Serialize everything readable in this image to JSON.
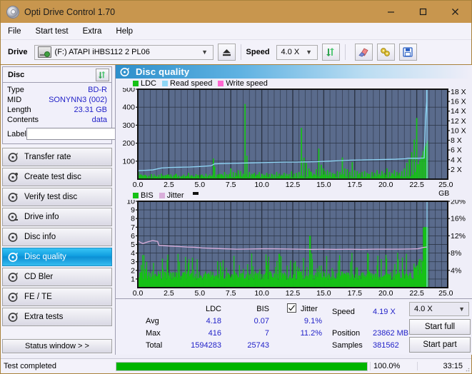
{
  "titlebar": {
    "title": "Opti Drive Control 1.70",
    "icon": "disc-icon",
    "minimize": "–",
    "maximize": "□",
    "close": "✕"
  },
  "menubar": {
    "items": [
      "File",
      "Start test",
      "Extra",
      "Help"
    ]
  },
  "toolbar": {
    "drive_label": "Drive",
    "drive_value": "(F:)  ATAPI iHBS112  2 PL06",
    "eject_icon": "eject-icon",
    "speed_label": "Speed",
    "speed_value": "4.0 X",
    "refresh_icon": "refresh-icon",
    "eraser_icon": "eraser-icon",
    "tools_icon": "tools-icon",
    "save_icon": "save-disk-icon"
  },
  "sidebar": {
    "disc": {
      "header": "Disc",
      "refresh_icon": "refresh-icon",
      "rows": [
        {
          "key": "Type",
          "value": "BD-R"
        },
        {
          "key": "MID",
          "value": "SONYNN3 (002)"
        },
        {
          "key": "Length",
          "value": "23.31 GB"
        },
        {
          "key": "Contents",
          "value": "data"
        }
      ],
      "label_key": "Label",
      "label_value": "",
      "label_placeholder": "",
      "disc_button_icon": "cd-disc-icon"
    },
    "nav": [
      {
        "label": "Transfer rate",
        "icon": "disc-test-icon",
        "active": false
      },
      {
        "label": "Create test disc",
        "icon": "disc-burn-icon",
        "active": false
      },
      {
        "label": "Verify test disc",
        "icon": "disc-verify-icon",
        "active": false
      },
      {
        "label": "Drive info",
        "icon": "drive-info-icon",
        "active": false
      },
      {
        "label": "Disc info",
        "icon": "disc-info-icon",
        "active": false
      },
      {
        "label": "Disc quality",
        "icon": "disc-quality-icon",
        "active": true
      },
      {
        "label": "CD Bler",
        "icon": "cd-bler-icon",
        "active": false
      },
      {
        "label": "FE / TE",
        "icon": "fe-te-icon",
        "active": false
      },
      {
        "label": "Extra tests",
        "icon": "extra-tests-icon",
        "active": false
      }
    ],
    "status_window_button": "Status window > >"
  },
  "panel": {
    "title": "Disc quality",
    "icon": "disc-quality-icon"
  },
  "stats": {
    "col_ldc": "LDC",
    "col_bis": "BIS",
    "jitter_label": "Jitter",
    "jitter_checked": true,
    "rows": [
      {
        "label": "Avg",
        "ldc": "4.18",
        "bis": "0.07",
        "jitter": "9.1%"
      },
      {
        "label": "Max",
        "ldc": "416",
        "bis": "7",
        "jitter": "11.2%"
      },
      {
        "label": "Total",
        "ldc": "1594283",
        "bis": "25743",
        "jitter": ""
      }
    ],
    "speed_label": "Speed",
    "speed_value": "4.19 X",
    "position_label": "Position",
    "position_value": "23862 MB",
    "samples_label": "Samples",
    "samples_value": "381562",
    "speed_select": "4.0 X",
    "start_full": "Start full",
    "start_part": "Start part"
  },
  "statusbar": {
    "message": "Test completed",
    "percent_text": "100.0%",
    "percent_value": 100,
    "time": "33:15"
  },
  "colors": {
    "titlebar": "#C8964E",
    "plot_bg": "#5A6B8C",
    "grid": "#2B3445",
    "ldc_green": "#16C116",
    "read_speed": "#8FD6F5",
    "write_speed": "#FF66D0",
    "jitter_pink": "#D9AEDA",
    "accent_blue": "#2222C8",
    "progress_green": "#00B400",
    "nav_active": "#0F9DE0"
  },
  "chart_data": [
    {
      "type": "line",
      "name": "top-chart",
      "title": "Disc quality",
      "legend": [
        {
          "label": "LDC",
          "color": "#16C116"
        },
        {
          "label": "Read speed",
          "color": "#8FD6F5"
        },
        {
          "label": "Write speed",
          "color": "#FF66D0"
        }
      ],
      "legend_position": "top-left",
      "grid": true,
      "xlabel": "GB",
      "xlim": [
        0,
        25
      ],
      "xticks": [
        0.0,
        2.5,
        5.0,
        7.5,
        10.0,
        12.5,
        15.0,
        17.5,
        20.0,
        22.5,
        25.0
      ],
      "xticklabels": [
        "0.0",
        "2.5",
        "5.0",
        "7.5",
        "10.0",
        "12.5",
        "15.0",
        "17.5",
        "20.0",
        "22.5",
        "25.0 GB"
      ],
      "ylabel": "LDC",
      "ylim": [
        0,
        500
      ],
      "yticks": [
        100,
        200,
        300,
        400,
        500
      ],
      "yticklabels": [
        "100",
        "200",
        "300",
        "400",
        "500"
      ],
      "y2label": "Speed",
      "y2lim": [
        0,
        18.5
      ],
      "y2ticks": [
        2,
        4,
        6,
        8,
        10,
        12,
        14,
        16,
        18
      ],
      "y2ticklabels": [
        "2 X",
        "4 X",
        "6 X",
        "8 X",
        "10 X",
        "12 X",
        "14 X",
        "16 X",
        "18 X"
      ],
      "series": [
        {
          "name": "LDC",
          "type": "bar",
          "color": "#16C116",
          "axis": "left",
          "x": [
            0.05,
            0.2,
            0.35,
            0.5,
            0.7,
            0.9,
            1.1,
            1.3,
            1.5,
            1.7,
            1.9,
            2.1,
            2.3,
            2.5,
            2.7,
            2.9,
            3.1,
            3.3,
            3.5,
            3.7,
            3.9,
            4.1,
            4.3,
            4.5,
            4.7,
            4.9,
            5.1,
            5.3,
            5.5,
            5.7,
            5.9,
            6.1,
            6.2,
            6.4,
            6.6,
            6.8,
            7.0,
            7.2,
            7.4,
            7.5,
            7.7,
            7.9,
            8.1,
            8.3,
            8.5,
            8.65,
            8.8,
            9.0,
            9.2,
            9.4,
            9.6,
            9.8,
            10.0,
            10.2,
            10.4,
            10.6,
            10.8,
            11.0,
            11.2,
            11.4,
            11.6,
            11.8,
            12.0,
            12.2,
            12.4,
            12.6,
            12.8,
            13.0,
            13.2,
            13.4,
            13.6,
            13.8,
            13.9,
            14.0,
            14.2,
            14.4,
            14.6,
            14.8,
            14.95,
            15.1,
            15.3,
            15.5,
            15.7,
            15.9,
            16.1,
            16.3,
            16.5,
            16.7,
            16.9,
            17.1,
            17.3,
            17.5,
            17.7,
            17.9,
            18.1,
            18.3,
            18.5,
            18.7,
            18.9,
            19.1,
            19.3,
            19.5,
            19.7,
            19.9,
            20.1,
            20.3,
            20.5,
            20.7,
            20.9,
            21.1,
            21.3,
            21.5,
            21.7,
            21.9,
            22.1,
            22.3,
            22.5,
            22.7,
            22.9,
            23.0,
            23.1,
            23.2,
            23.3
          ],
          "values": [
            40,
            25,
            18,
            22,
            16,
            20,
            28,
            15,
            18,
            24,
            30,
            20,
            16,
            25,
            18,
            22,
            30,
            20,
            15,
            25,
            18,
            35,
            20,
            15,
            28,
            20,
            24,
            18,
            30,
            20,
            16,
            115,
            70,
            25,
            30,
            20,
            40,
            25,
            30,
            60,
            40,
            35,
            50,
            45,
            30,
            418,
            130,
            40,
            30,
            35,
            25,
            40,
            30,
            25,
            35,
            28,
            30,
            25,
            40,
            30,
            25,
            35,
            30,
            28,
            45,
            30,
            35,
            40,
            285,
            120,
            90,
            60,
            45,
            40,
            30,
            55,
            170,
            80,
            60,
            45,
            50,
            40,
            35,
            30,
            45,
            40,
            120,
            60,
            55,
            40,
            95,
            50,
            45,
            35,
            40,
            45,
            35,
            30,
            40,
            35,
            50,
            30,
            45,
            35,
            60,
            40,
            35,
            50,
            40,
            35,
            45,
            60,
            90,
            110,
            150,
            220,
            340
          ]
        },
        {
          "name": "Read speed",
          "type": "line",
          "color": "#8FD6F5",
          "axis": "right",
          "x": [
            0.0,
            0.6,
            1.2,
            1.9,
            2.6,
            3.4,
            4.2,
            5.0,
            5.9,
            6.2,
            6.8,
            7.6,
            8.4,
            9.2,
            10.0,
            10.9,
            11.8,
            12.7,
            13.6,
            14.5,
            15.4,
            16.3,
            17.2,
            18.1,
            19.0,
            19.9,
            20.8,
            21.6,
            21.8,
            22.6,
            23.1,
            23.2,
            23.3,
            23.3
          ],
          "values": [
            1.75,
            1.82,
            1.9,
            2.3,
            2.4,
            2.45,
            2.5,
            2.6,
            2.75,
            3.15,
            3.2,
            3.25,
            3.3,
            3.35,
            3.4,
            3.45,
            3.5,
            3.5,
            3.55,
            3.6,
            3.7,
            3.8,
            3.9,
            3.95,
            4.0,
            4.05,
            4.1,
            4.2,
            4.3,
            4.3,
            4.35,
            12.0,
            16.0,
            18.4
          ]
        }
      ]
    },
    {
      "type": "line",
      "name": "bottom-chart",
      "legend": [
        {
          "label": "BIS",
          "color": "#16C116"
        },
        {
          "label": "Jitter",
          "color": "#D9AEDA"
        }
      ],
      "legend_position": "top-left",
      "grid": true,
      "xlabel": "GB",
      "xlim": [
        0,
        25
      ],
      "xticks": [
        0.0,
        2.5,
        5.0,
        7.5,
        10.0,
        12.5,
        15.0,
        17.5,
        20.0,
        22.5,
        25.0
      ],
      "xticklabels": [
        "0.0",
        "2.5",
        "5.0",
        "7.5",
        "10.0",
        "12.5",
        "15.0",
        "17.5",
        "20.0",
        "22.5",
        "25.0 GB"
      ],
      "ylabel": "BIS",
      "ylim": [
        0,
        10
      ],
      "yticks": [
        1,
        2,
        3,
        4,
        5,
        6,
        7,
        8,
        9,
        10
      ],
      "yticklabels": [
        "1",
        "2",
        "3",
        "4",
        "5",
        "6",
        "7",
        "8",
        "9",
        "10"
      ],
      "y2label": "Jitter",
      "y2lim": [
        0,
        20
      ],
      "y2ticks": [
        4,
        8,
        12,
        16,
        20
      ],
      "y2ticklabels": [
        "4%",
        "8%",
        "12%",
        "16%",
        "20%"
      ],
      "series": [
        {
          "name": "BIS",
          "type": "bar",
          "color": "#16C116",
          "axis": "left",
          "base_level": 1.6,
          "note": "dense bars averaging ~1-2 with spikes to 3-4; big rise to 7 near 23 GB"
        },
        {
          "name": "Jitter",
          "type": "line",
          "color": "#D9AEDA",
          "axis": "right",
          "x": [
            0.0,
            0.4,
            0.8,
            1.2,
            1.6,
            1.7,
            2.2,
            2.8,
            3.4,
            4.0,
            4.6,
            5.2,
            6.0,
            7.0,
            8.0,
            9.0,
            10.0,
            11.0,
            12.0,
            13.0,
            14.0,
            15.0,
            16.0,
            17.0,
            18.0,
            19.0,
            20.0,
            21.0,
            22.0,
            22.6,
            23.0,
            23.3
          ],
          "values": [
            10.8,
            10.2,
            10.6,
            10.9,
            10.7,
            9.8,
            9.7,
            9.6,
            9.5,
            9.4,
            9.35,
            9.2,
            9.1,
            9.0,
            8.9,
            8.95,
            9.0,
            9.0,
            8.95,
            8.9,
            8.85,
            8.9,
            8.85,
            8.9,
            8.85,
            8.9,
            8.9,
            8.9,
            8.95,
            9.0,
            9.3,
            9.4
          ]
        }
      ]
    }
  ]
}
